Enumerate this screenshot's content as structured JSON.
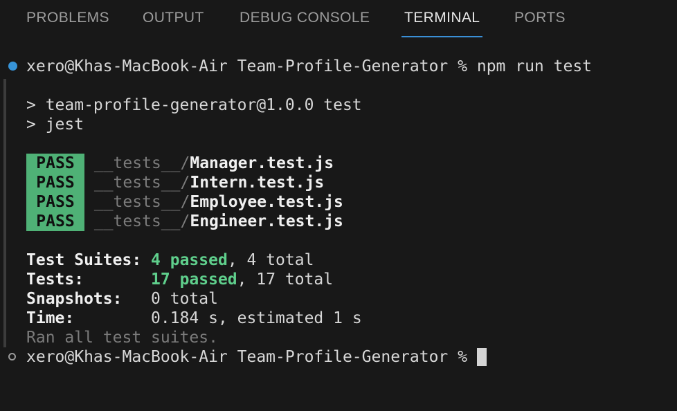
{
  "tabs": [
    "PROBLEMS",
    "OUTPUT",
    "DEBUG CONSOLE",
    "TERMINAL",
    "PORTS"
  ],
  "active_tab": "TERMINAL",
  "prompt": "xero@Khas-MacBook-Air Team-Profile-Generator %",
  "command": "npm run test",
  "script_header": [
    "> team-profile-generator@1.0.0 test",
    "> jest"
  ],
  "results": [
    {
      "status": "PASS",
      "dir": "__tests__/",
      "file": "Manager.test.js"
    },
    {
      "status": "PASS",
      "dir": "__tests__/",
      "file": "Intern.test.js"
    },
    {
      "status": "PASS",
      "dir": "__tests__/",
      "file": "Employee.test.js"
    },
    {
      "status": "PASS",
      "dir": "__tests__/",
      "file": "Engineer.test.js"
    }
  ],
  "summary": {
    "suites_label": "Test Suites:",
    "suites_passed": "4 passed",
    "suites_total": ", 4 total",
    "tests_label": "Tests:",
    "tests_passed": "17 passed",
    "tests_total": ", 17 total",
    "snapshots_label": "Snapshots:",
    "snapshots_value": "0 total",
    "time_label": "Time:",
    "time_value": "0.184 s, estimated 1 s",
    "footer": "Ran all test suites."
  },
  "colors": {
    "background": "#181818",
    "pass_badge": "#4fb176",
    "passed_text": "#5fcf8c",
    "active_tab_underline": "#3a8fd6",
    "command_done_dot": "#3794d8"
  }
}
